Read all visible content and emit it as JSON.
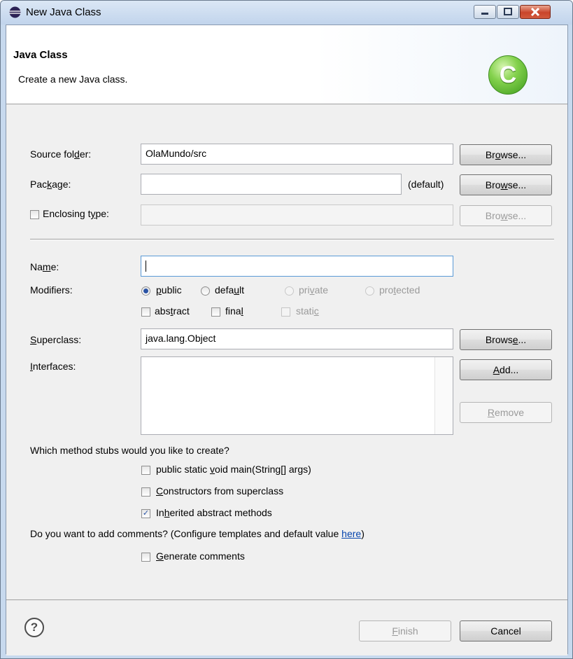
{
  "window": {
    "title": "New Java Class",
    "icon": "eclipse-icon",
    "controls": [
      "minimize-icon",
      "maximize-icon",
      "close-icon"
    ]
  },
  "banner": {
    "title": "Java Class",
    "description": "Create a new Java class.",
    "icon_glyph": "C"
  },
  "source_folder": {
    "label": "Source fol",
    "label_ul": "d",
    "label_rest": "er:",
    "value": "OlaMundo/src",
    "browse_a": "Br",
    "browse_ul": "o",
    "browse_b": "wse..."
  },
  "package": {
    "label": "Pac",
    "label_ul": "k",
    "label_rest": "age:",
    "value": "",
    "default_hint": "(default)",
    "browse_a": "Bro",
    "browse_ul": "w",
    "browse_b": "se..."
  },
  "enclosing_type": {
    "label": "Enclosing t",
    "label_ul": "y",
    "label_rest": "pe:",
    "checked": false,
    "value": "",
    "browse_a": "Bro",
    "browse_ul": "w",
    "browse_b": "se..."
  },
  "name": {
    "label": "Na",
    "label_ul": "m",
    "label_rest": "e:",
    "value": ""
  },
  "modifiers": {
    "label": "Modifiers:",
    "public": {
      "a": "",
      "ul": "p",
      "b": "ublic",
      "selected": true
    },
    "default": {
      "a": "defa",
      "ul": "u",
      "b": "lt",
      "selected": false
    },
    "private": {
      "a": "pri",
      "ul": "v",
      "b": "ate",
      "selected": false
    },
    "protected": {
      "a": "pro",
      "ul": "t",
      "b": "ected",
      "selected": false
    },
    "abstract": {
      "a": "abs",
      "ul": "t",
      "b": "ract",
      "checked": false
    },
    "final": {
      "a": "fina",
      "ul": "l",
      "b": "",
      "checked": false
    },
    "static": {
      "a": "stati",
      "ul": "c",
      "b": "",
      "checked": false
    }
  },
  "superclass": {
    "label_ul": "S",
    "label_rest": "uperclass:",
    "value": "java.lang.Object",
    "browse_a": "Brows",
    "browse_ul": "e",
    "browse_b": "..."
  },
  "interfaces": {
    "label_ul": "I",
    "label_rest": "nterfaces:",
    "add_ul": "A",
    "add_rest": "dd...",
    "remove_ul": "R",
    "remove_rest": "emove"
  },
  "stubs": {
    "question": "Which method stubs would you like to create?",
    "main": {
      "a": "public static ",
      "ul": "v",
      "b": "oid main(String[] args)",
      "checked": false
    },
    "constructors": {
      "a": "",
      "ul": "C",
      "b": "onstructors from superclass",
      "checked": false
    },
    "inherited": {
      "a": "In",
      "ul": "h",
      "b": "erited abstract methods",
      "checked": true
    }
  },
  "comments": {
    "question": "Do you want to add comments? (Configure templates and default value ",
    "link": "here",
    "close_paren": ")",
    "generate": {
      "a": "",
      "ul": "G",
      "b": "enerate comments",
      "checked": false
    }
  },
  "footer": {
    "help_glyph": "?",
    "finish_ul": "F",
    "finish_rest": "inish",
    "cancel": "Cancel"
  },
  "colors": {
    "window_frame": "#c7d9ee",
    "dialog_body": "#f0f0f0",
    "selection": "#2a53a4",
    "link": "#0645ad",
    "close_button": "#c9452b"
  }
}
